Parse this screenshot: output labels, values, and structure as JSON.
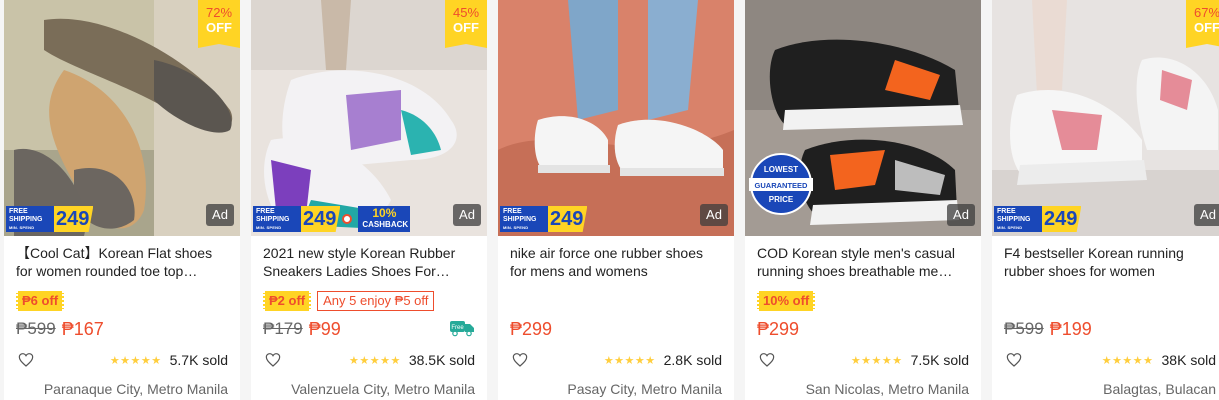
{
  "colors": {
    "accent": "#ee4d2d",
    "badge_yellow": "#ffd424",
    "ship_blue": "#1a47b8"
  },
  "badges": {
    "off_word": "OFF",
    "ad_label": "Ad",
    "free_shipping_line1": "FREE",
    "free_shipping_line2": "SHIPPING",
    "min_spend": "MIN. SPEND",
    "ship_amount": "249",
    "cashback_pct": "10%",
    "cashback_word": "CASHBACK",
    "free_word": "Free"
  },
  "products": [
    {
      "title": "【Cool Cat】Korean Flat shoes for women rounded toe top…",
      "discount": "72%",
      "voucher": "₱6 off",
      "promo": "",
      "original_price": "₱599",
      "price": "₱167",
      "rating": "★★★★★",
      "sold": "5.7K sold",
      "location": "Paranaque City, Metro Manila"
    },
    {
      "title": "2021 new style Korean Rubber Sneakers Ladies Shoes For…",
      "discount": "45%",
      "voucher": "₱2 off",
      "promo": "Any 5 enjoy ₱5 off",
      "original_price": "₱179",
      "price": "₱99",
      "rating": "★★★★★",
      "sold": "38.5K sold",
      "location": "Valenzuela City, Metro Manila"
    },
    {
      "title": "nike air force one rubber shoes for mens and womens",
      "discount": "",
      "voucher": "",
      "promo": "",
      "original_price": "",
      "price": "₱299",
      "rating": "★★★★★",
      "sold": "2.8K sold",
      "location": "Pasay City, Metro Manila"
    },
    {
      "title": "COD Korean style men's casual running shoes breathable me…",
      "discount": "",
      "voucher": "10% off",
      "promo": "",
      "original_price": "",
      "price": "₱299",
      "rating": "★★★★★",
      "sold": "7.5K sold",
      "location": "San Nicolas, Metro Manila"
    },
    {
      "title": "F4 bestseller Korean running rubber shoes for women",
      "discount": "67%",
      "voucher": "",
      "promo": "",
      "original_price": "₱599",
      "price": "₱199",
      "rating": "★★★★★",
      "sold": "38K sold",
      "location": "Balagtas, Bulacan"
    }
  ],
  "guarantee_stamp": {
    "line1": "LOWEST",
    "line2": "GUARANTEED",
    "line3": "PRICE"
  }
}
